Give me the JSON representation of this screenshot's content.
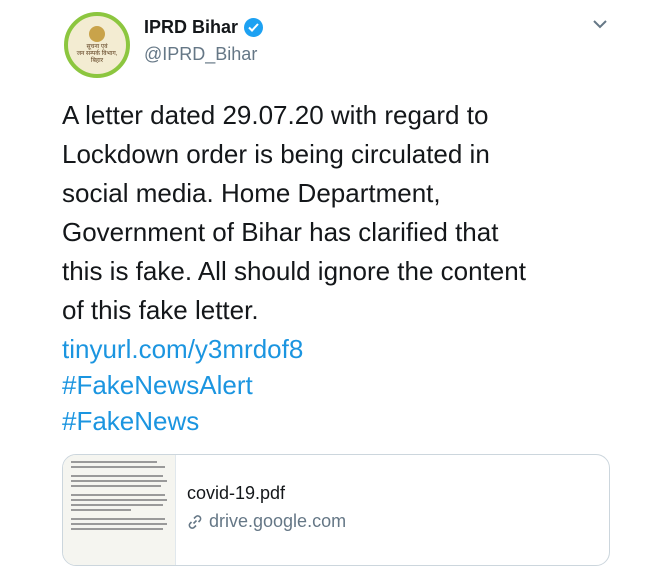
{
  "tweet": {
    "author_name": "IPRD Bihar",
    "handle": "@IPRD_Bihar",
    "avatar_text": [
      "सूचना एवं",
      "जन सम्पर्क विभाग,",
      "बिहार"
    ],
    "text_lines": [
      "A letter dated 29.07.20 with regard to",
      "Lockdown order is being circulated in",
      "social media. Home Department,",
      "Government of Bihar has clarified that",
      "this is fake. All should ignore the content",
      "of this fake letter."
    ],
    "link": "tinyurl.com/y3mrdof8",
    "hashtags": [
      "#FakeNewsAlert",
      "#FakeNews"
    ]
  },
  "attachment": {
    "file_name": "covid-19.pdf",
    "domain": "drive.google.com",
    "thumbnail_lines": [
      "And whereas, there is an alarming surge in COVID-19",
      "that it has been seen whereas positivity rate has also",
      "And whereas, the Government has examined the matter",
      "that the requirement for a lockdown in following manner",
      "ensure the further spread of the COVID-19 within the State",
      "And Whereas, vide letter no.D.O.No.40-3/2020-DM-I(A)",
      "of the Home Secretary, Govt. of India, Home, based on",
      "which may prohibit certain activities in areas outside",
      "restrictions as deemed necessary.",
      "Now, therefore, in exercise of the powers conferred",
      "issued by the Ministry of Home Affairs, Govt. of India",
      "hereby that the guidelines as follows, will remain in force"
    ]
  },
  "colors": {
    "link": "#1b95e0",
    "verified": "#1da1f2",
    "avatar_ring": "#8cc63f",
    "muted": "#657786"
  },
  "icons": [
    "verified-badge-icon",
    "chevron-down-icon",
    "link-icon"
  ]
}
